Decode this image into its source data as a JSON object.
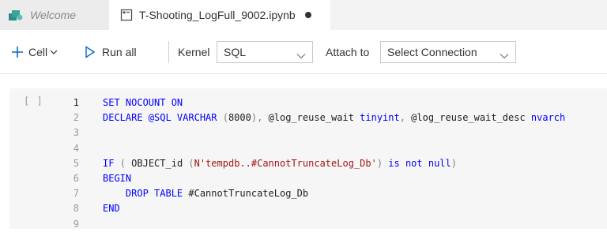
{
  "tabs": {
    "welcome": {
      "label": "Welcome"
    },
    "notebook": {
      "label": "T-Shooting_LogFull_9002.ipynb"
    }
  },
  "toolbar": {
    "cell_label": "Cell",
    "run_all_label": "Run all",
    "kernel_label": "Kernel",
    "kernel_value": "SQL",
    "attach_label": "Attach to",
    "attach_value": "Select Connection"
  },
  "cell": {
    "execution_count": "[ ]",
    "line_numbers": [
      "1",
      "2",
      "3",
      "4",
      "5",
      "6",
      "7",
      "8",
      "9"
    ],
    "lines": [
      [
        {
          "t": "SET NOCOUNT ON",
          "c": "kw"
        }
      ],
      [
        {
          "t": "DECLARE @SQL ",
          "c": "kw"
        },
        {
          "t": "VARCHAR ",
          "c": "kw"
        },
        {
          "t": "(",
          "c": "gray"
        },
        {
          "t": "8000",
          "c": "plain"
        },
        {
          "t": "), ",
          "c": "gray"
        },
        {
          "t": "@log_reuse_wait ",
          "c": "plain"
        },
        {
          "t": "tinyint",
          "c": "kw"
        },
        {
          "t": ", ",
          "c": "gray"
        },
        {
          "t": "@log_reuse_wait_desc ",
          "c": "plain"
        },
        {
          "t": "nvarch",
          "c": "kw"
        }
      ],
      [],
      [],
      [
        {
          "t": "IF ",
          "c": "kw"
        },
        {
          "t": "( ",
          "c": "gray"
        },
        {
          "t": "OBJECT_id ",
          "c": "plain"
        },
        {
          "t": "(",
          "c": "gray"
        },
        {
          "t": "N'tempdb..#CannotTruncateLog_Db'",
          "c": "str"
        },
        {
          "t": ") ",
          "c": "gray"
        },
        {
          "t": "is not null",
          "c": "kw"
        },
        {
          "t": ")",
          "c": "gray"
        }
      ],
      [
        {
          "t": "BEGIN",
          "c": "kw"
        }
      ],
      [
        {
          "t": "    DROP TABLE ",
          "c": "kw"
        },
        {
          "t": "#CannotTruncateLog_Db",
          "c": "plain"
        }
      ],
      [
        {
          "t": "END",
          "c": "kw"
        }
      ],
      []
    ]
  }
}
